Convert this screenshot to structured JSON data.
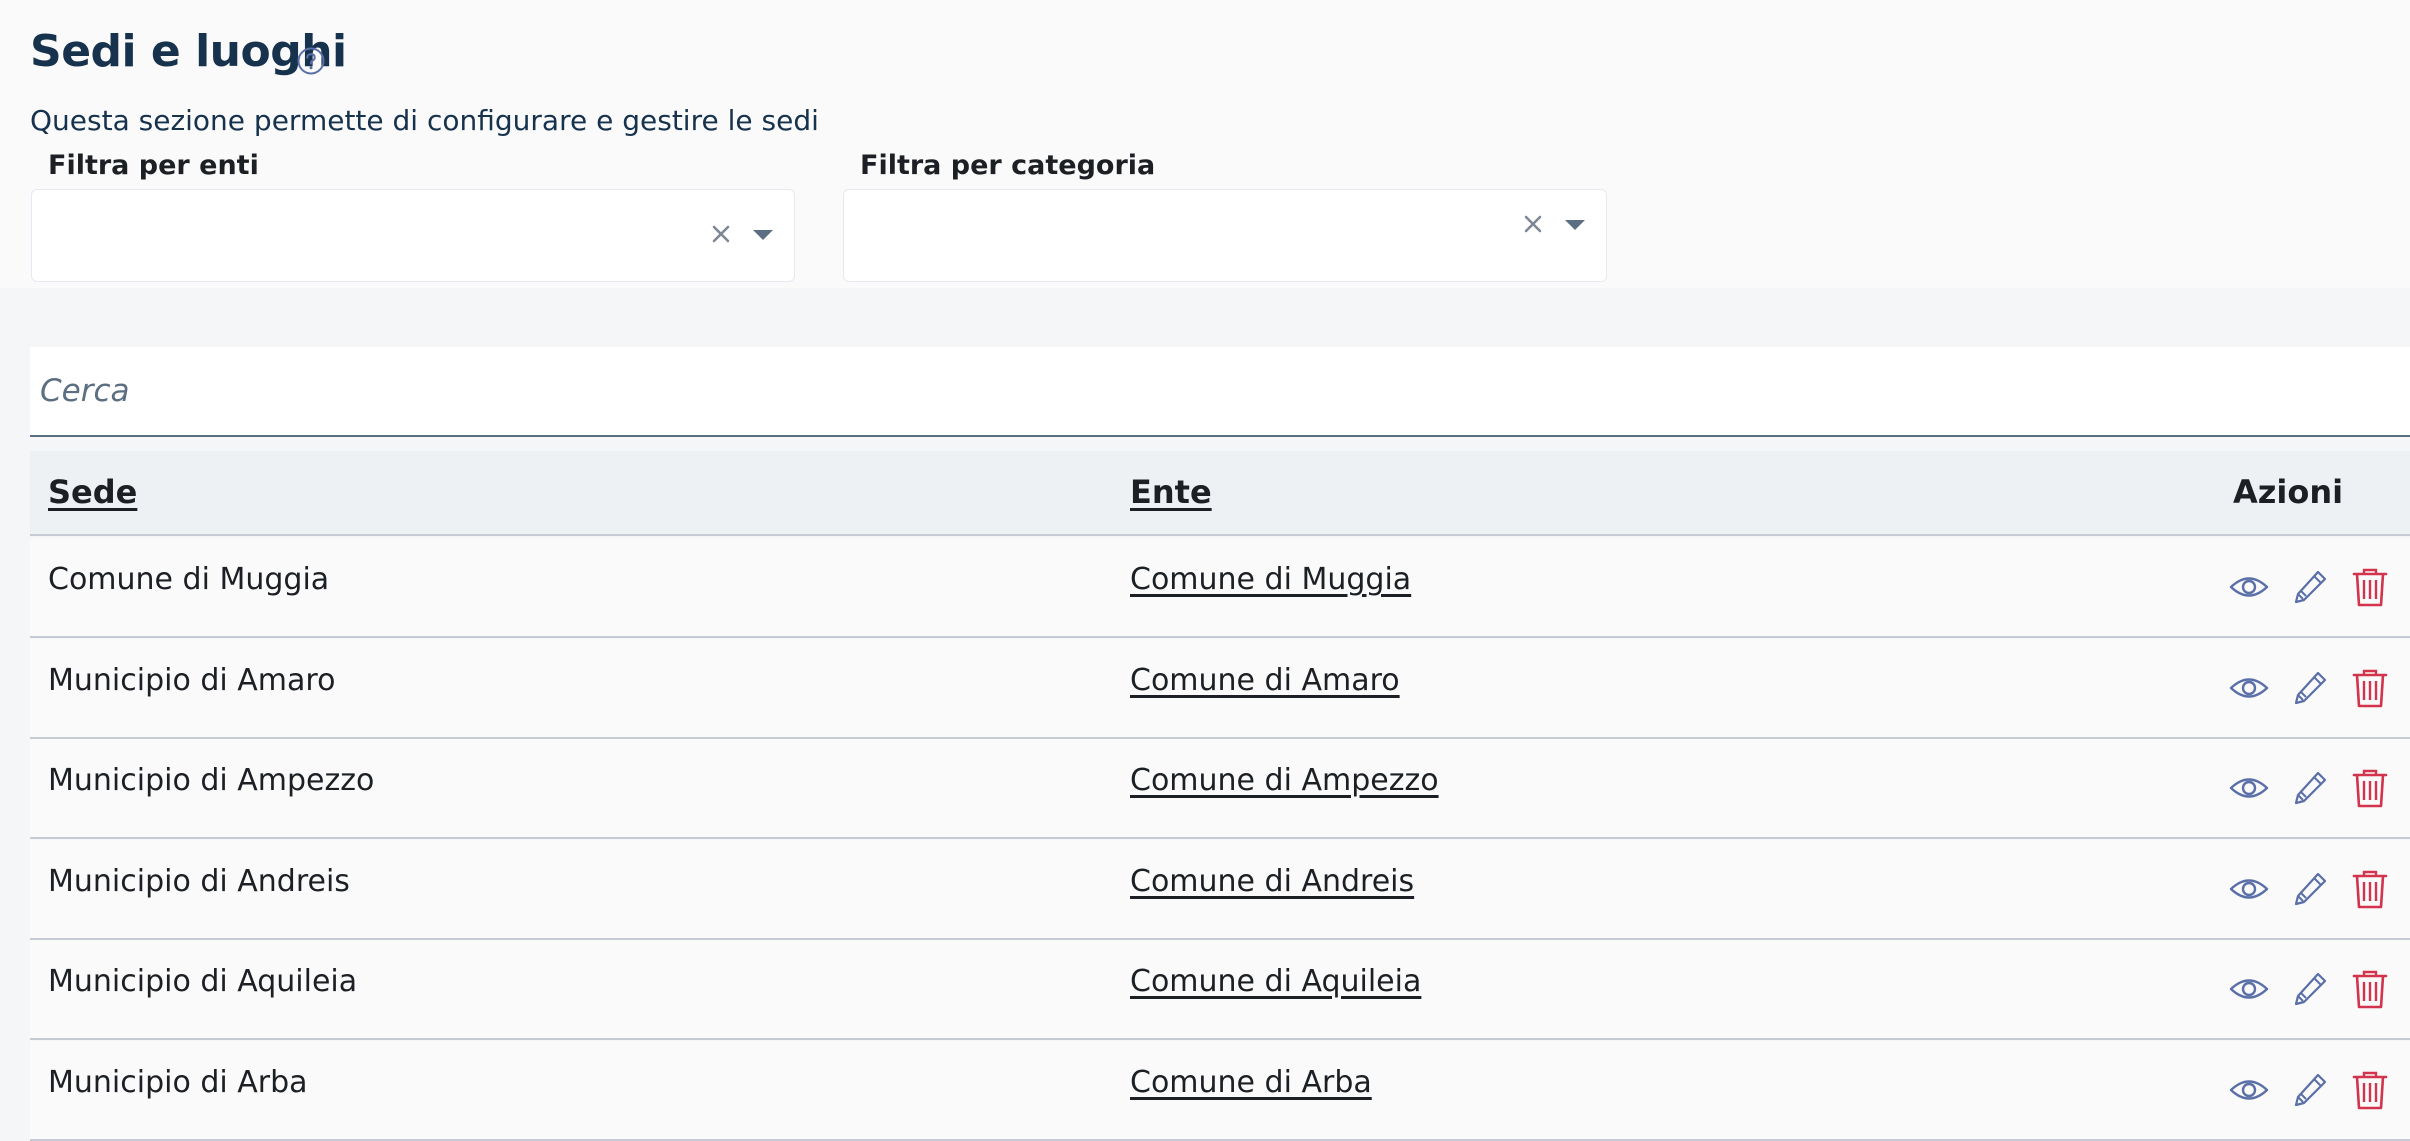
{
  "page": {
    "title": "Sedi e luoghi",
    "description": "Questa sezione permette di configurare e gestire le sedi"
  },
  "filters": {
    "enti": {
      "label": "Filtra per enti",
      "value": ""
    },
    "categoria": {
      "label": "Filtra per categoria",
      "value": ""
    }
  },
  "search": {
    "placeholder": "Cerca",
    "value": ""
  },
  "table": {
    "columns": {
      "sede": "Sede",
      "ente": "Ente",
      "azioni": "Azioni"
    },
    "rows": [
      {
        "sede": "Comune di Muggia",
        "ente": "Comune di Muggia"
      },
      {
        "sede": "Municipio di Amaro",
        "ente": "Comune di Amaro"
      },
      {
        "sede": "Municipio di Ampezzo",
        "ente": "Comune di Ampezzo"
      },
      {
        "sede": "Municipio di Andreis",
        "ente": "Comune di Andreis"
      },
      {
        "sede": "Municipio di Aquileia",
        "ente": "Comune di Aquileia"
      },
      {
        "sede": "Municipio di Arba",
        "ente": "Comune di Arba"
      }
    ],
    "row_actions": [
      "eye-icon",
      "pencil-icon",
      "trash-icon"
    ]
  },
  "colors": {
    "primary": "#17324d",
    "action_icon": "#5a6fa8",
    "delete": "#d1344c"
  }
}
